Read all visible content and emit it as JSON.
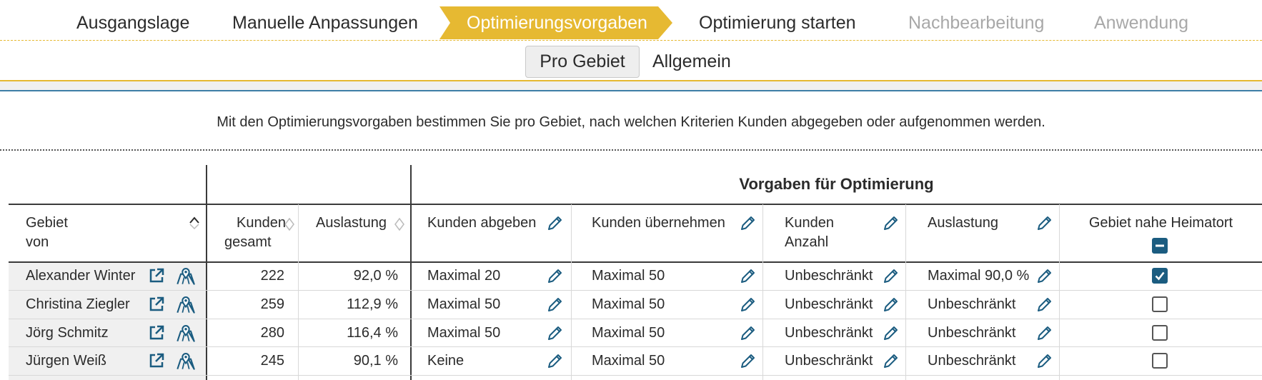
{
  "stepper": {
    "steps": [
      {
        "label": "Ausgangslage",
        "state": "done"
      },
      {
        "label": "Manuelle Anpassungen",
        "state": "done"
      },
      {
        "label": "Optimierungsvorgaben",
        "state": "active"
      },
      {
        "label": "Optimierung starten",
        "state": "next"
      },
      {
        "label": "Nachbearbeitung",
        "state": "disabled"
      },
      {
        "label": "Anwendung",
        "state": "disabled"
      }
    ]
  },
  "subtabs": {
    "active": "Pro Gebiet",
    "other": "Allgemein"
  },
  "intro": "Mit den Optimierungsvorgaben bestimmen Sie pro Gebiet, nach welchen Kriterien Kunden abgegeben oder aufgenommen werden.",
  "table": {
    "group_title": "Vorgaben für Optimierung",
    "columns": {
      "gebiet_line1": "Gebiet",
      "gebiet_line2": "von",
      "kunden_gesamt_line1": "Kunden",
      "kunden_gesamt_line2": "gesamt",
      "auslastung": "Auslastung",
      "kunden_abgeben": "Kunden abgeben",
      "kunden_uebernehmen": "Kunden übernehmen",
      "kunden_anzahl_line1": "Kunden",
      "kunden_anzahl_line2": "Anzahl",
      "vorgabe_auslastung": "Auslastung",
      "heimatort": "Gebiet nahe Heimatort"
    },
    "rows": [
      {
        "name": "Alexander Winter",
        "kunden": "222",
        "auslastung": "92,0 %",
        "abgeben": "Maximal 20",
        "uebernehmen": "Maximal 50",
        "anzahl": "Unbeschränkt",
        "vorgabe_auslastung": "Maximal 90,0 %",
        "heimatort": true
      },
      {
        "name": "Christina Ziegler",
        "kunden": "259",
        "auslastung": "112,9 %",
        "abgeben": "Maximal 50",
        "uebernehmen": "Maximal 50",
        "anzahl": "Unbeschränkt",
        "vorgabe_auslastung": "Unbeschränkt",
        "heimatort": false
      },
      {
        "name": "Jörg Schmitz",
        "kunden": "280",
        "auslastung": "116,4 %",
        "abgeben": "Maximal 50",
        "uebernehmen": "Maximal 50",
        "anzahl": "Unbeschränkt",
        "vorgabe_auslastung": "Unbeschränkt",
        "heimatort": false
      },
      {
        "name": "Jürgen Weiß",
        "kunden": "245",
        "auslastung": "90,1 %",
        "abgeben": "Keine",
        "uebernehmen": "Maximal 50",
        "anzahl": "Unbeschränkt",
        "vorgabe_auslastung": "Unbeschränkt",
        "heimatort": false
      }
    ]
  },
  "colors": {
    "accent": "#e6b932",
    "icon_blue": "#1b5c80",
    "disabled_text": "#a8a8a8"
  },
  "icons": {
    "row_open": "external-link-icon",
    "row_map": "map-pin-icon",
    "edit": "pencil-icon",
    "sort": "sort-icon",
    "sort_asc": "sort-up-icon"
  }
}
